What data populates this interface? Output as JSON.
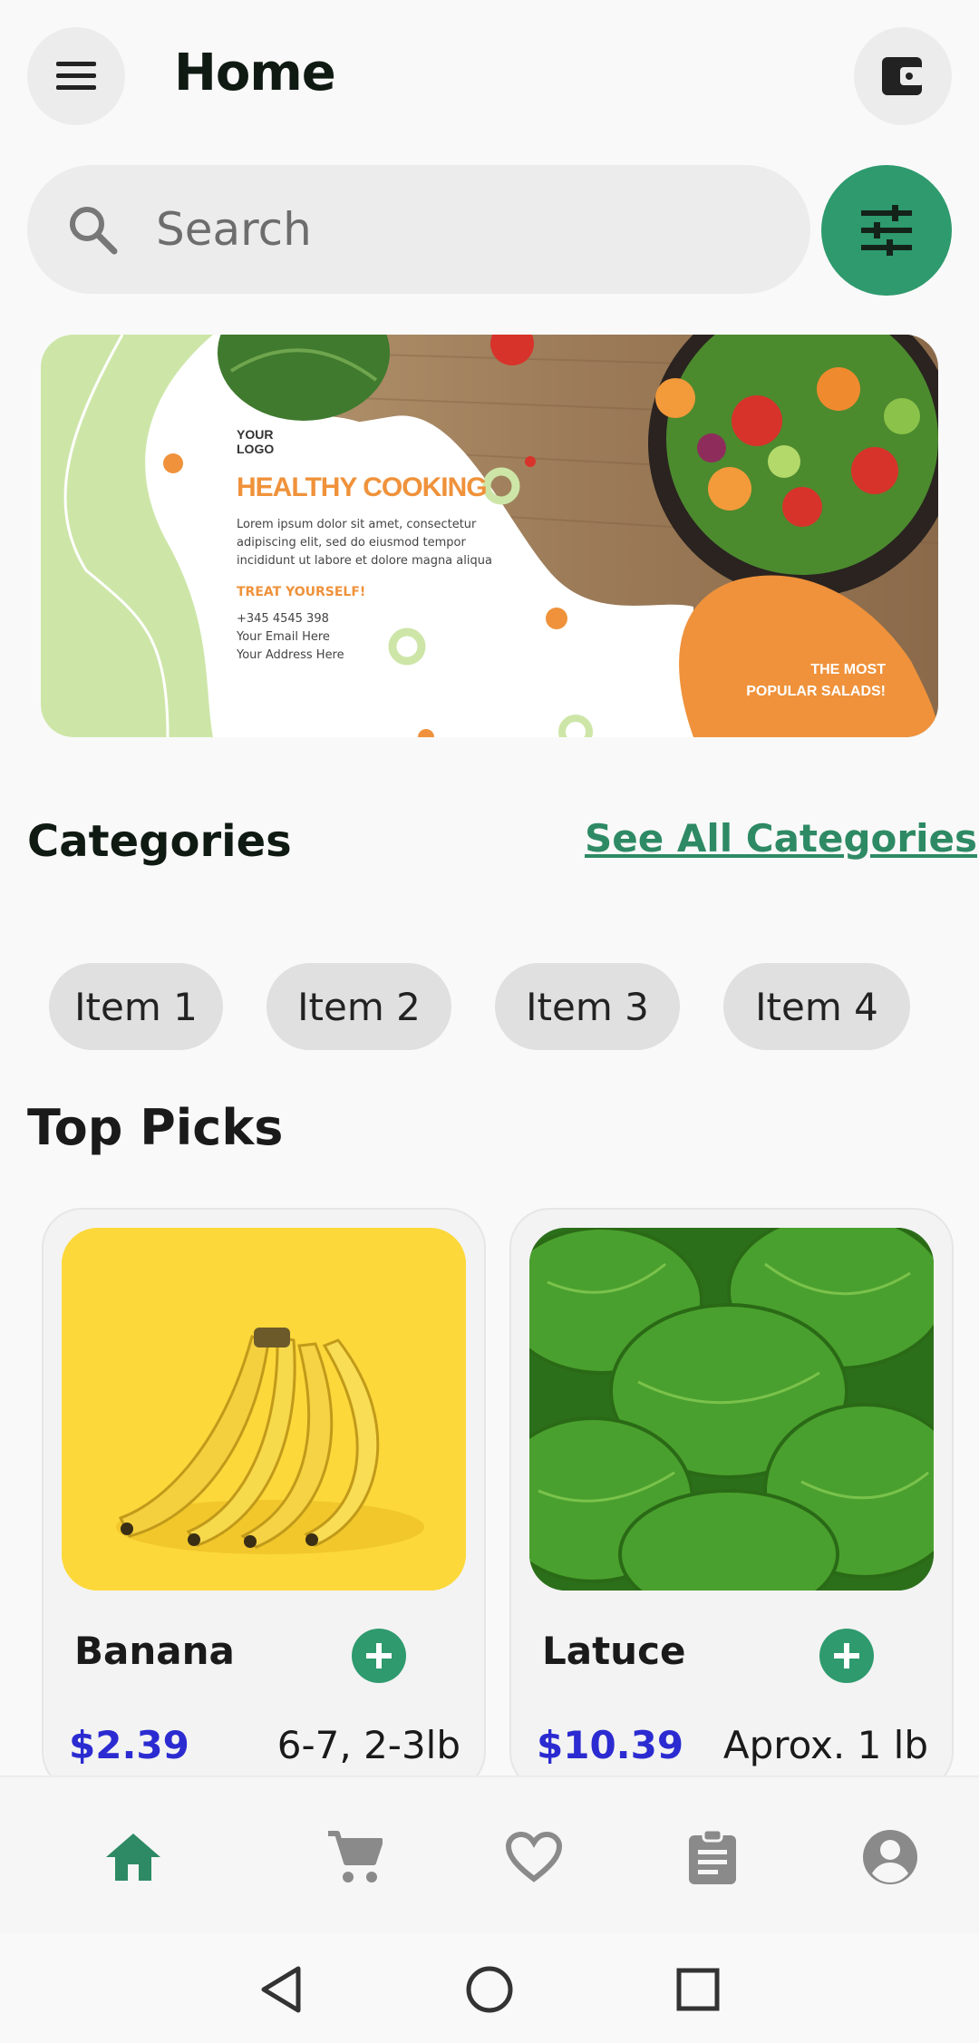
{
  "header": {
    "title": "Home",
    "menu_icon": "menu-icon",
    "wallet_icon": "wallet-icon"
  },
  "search": {
    "placeholder": "Search",
    "filter_icon": "tune-icon"
  },
  "banner": {
    "logo_text": "YOUR LOGO",
    "headline": "HEALTHY COOKING",
    "body": "Lorem ipsum dolor sit amet, consectetur adipiscing elit, sed do eiusmod tempor incididunt ut labore et dolore magna aliqua",
    "cta": "TREAT YOURSELF!",
    "phone": "+345 4545 398",
    "email": "Your Email Here",
    "address": "Your Address Here",
    "tagline_1": "THE MOST",
    "tagline_2": "POPULAR SALADS!",
    "colors": {
      "green": "#cde6a8",
      "orange": "#ef923b",
      "wood": "#a48462"
    }
  },
  "categories": {
    "title": "Categories",
    "see_all": "See All Categories",
    "items": [
      "Item 1",
      "Item 2",
      "Item 3",
      "Item 4"
    ]
  },
  "top_picks": {
    "title": "Top Picks",
    "products": [
      {
        "name": "Banana",
        "price": "$2.39",
        "weight": "6-7, 2-3lb"
      },
      {
        "name": "Latuce",
        "price": "$10.39",
        "weight": "Aprox. 1 lb"
      }
    ]
  },
  "bottom_nav": {
    "items": [
      "home-icon",
      "cart-icon",
      "heart-icon",
      "clipboard-icon",
      "account-icon"
    ],
    "active": "home-icon"
  },
  "system_nav": [
    "back-icon",
    "home-circle-icon",
    "recents-icon"
  ],
  "colors": {
    "accent": "#2e9a6e",
    "price": "#2b2bd1"
  }
}
